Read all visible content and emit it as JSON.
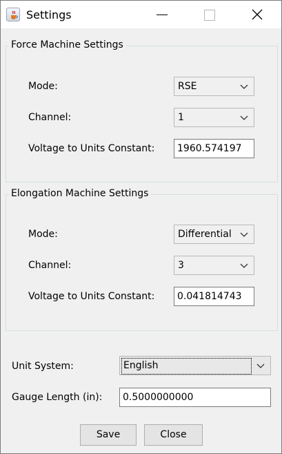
{
  "window": {
    "title": "Settings",
    "icon": "java-coffee-cup-icon"
  },
  "titlebar": {
    "minimize_icon": "minimize-icon",
    "maximize_icon": "maximize-icon",
    "close_icon": "close-icon"
  },
  "force": {
    "legend": "Force Machine Settings",
    "mode_label": "Mode:",
    "mode_value": "RSE",
    "channel_label": "Channel:",
    "channel_value": "1",
    "constant_label": "Voltage to Units Constant:",
    "constant_value": "1960.574197"
  },
  "elongation": {
    "legend": "Elongation Machine Settings",
    "mode_label": "Mode:",
    "mode_value": "Differential",
    "channel_label": "Channel:",
    "channel_value": "3",
    "constant_label": "Voltage to Units Constant:",
    "constant_value": "0.041814743"
  },
  "units": {
    "label": "Unit System:",
    "value": "English"
  },
  "gauge": {
    "label": "Gauge Length (in):",
    "value": "0.5000000000"
  },
  "buttons": {
    "save": "Save",
    "close": "Close"
  }
}
